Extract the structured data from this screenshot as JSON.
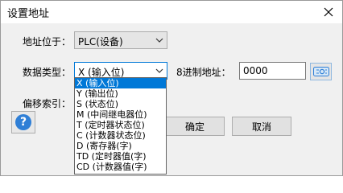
{
  "window": {
    "title": "设置地址"
  },
  "form": {
    "address_location_label": "地址位于：",
    "address_location_value": "PLC(设备)",
    "data_type_label": "数据类型：",
    "data_type_value": "X (输入位)",
    "octal_address_label": "8进制地址：",
    "octal_address_value": "0000",
    "offset_index_label": "偏移索引："
  },
  "buttons": {
    "ok": "确定",
    "cancel": "取消",
    "help": "?"
  },
  "dropdown_options": [
    "X (输入位)",
    "Y (输出位)",
    "S (状态位)",
    "M (中间继电器位)",
    "T (定时器状态位)",
    "C (计数器状态位)",
    "D (寄存器(字)",
    "TD (定时器值(字)",
    "CD (计数器值(字)"
  ],
  "selected_option_index": 0,
  "colors": {
    "selection": "#0078d7",
    "focus_border": "#0078d7",
    "help_circle": "#2f7fd6"
  }
}
